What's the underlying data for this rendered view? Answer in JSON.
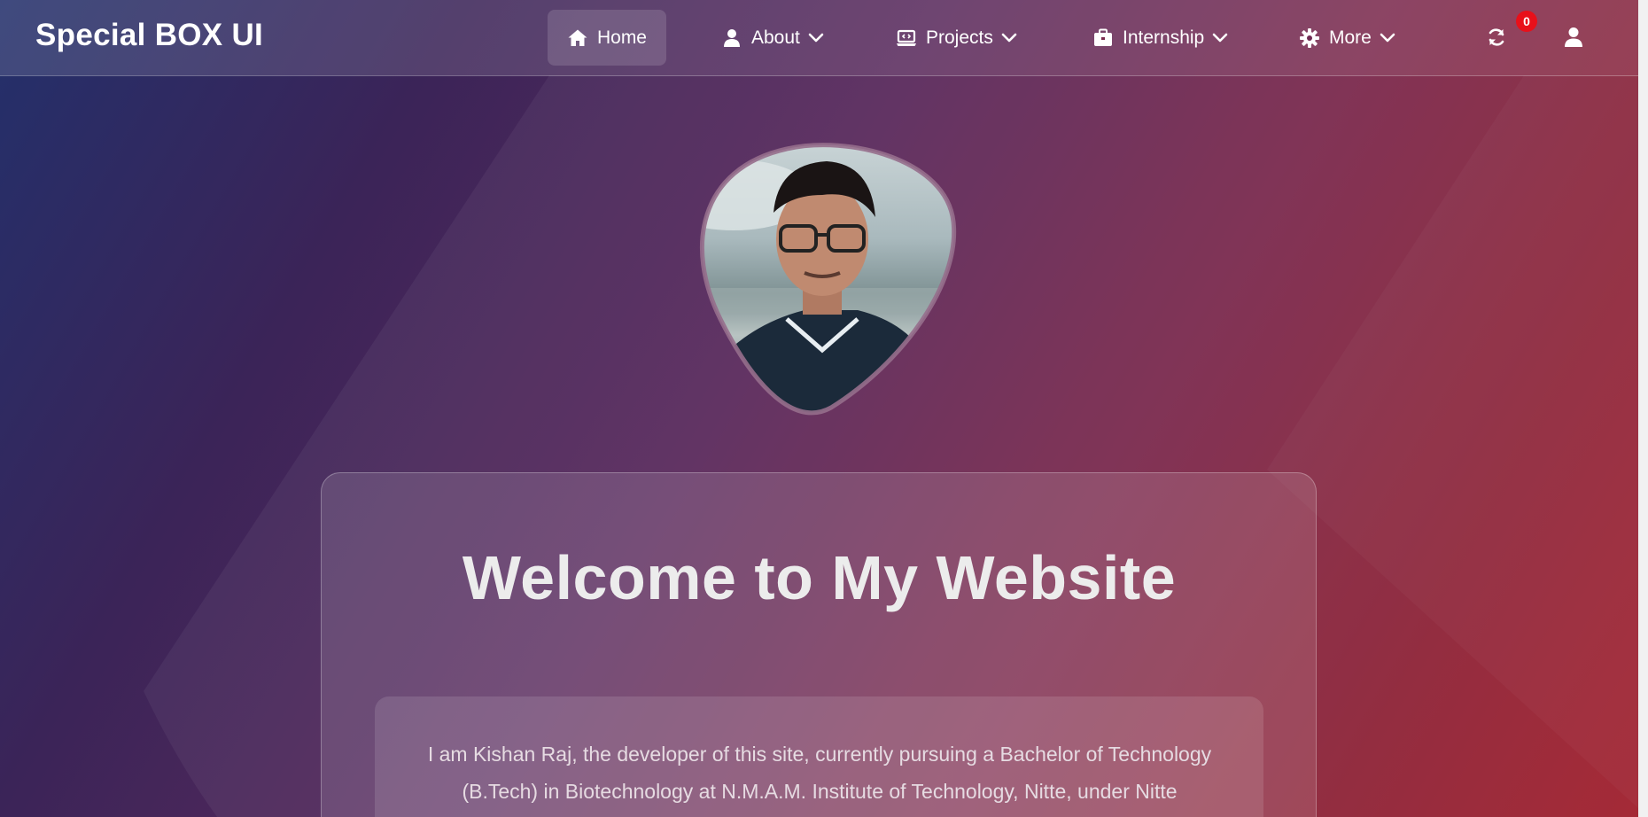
{
  "header": {
    "brand": "Special BOX UI",
    "nav": [
      {
        "label": "Home",
        "icon": "home-icon",
        "active": true
      },
      {
        "label": "About",
        "icon": "user-icon",
        "dropdown": true
      },
      {
        "label": "Projects",
        "icon": "laptop-code-icon",
        "dropdown": true
      },
      {
        "label": "Internship",
        "icon": "briefcase-icon",
        "dropdown": true
      },
      {
        "label": "More",
        "icon": "gear-icon",
        "dropdown": true
      }
    ],
    "refresh_badge_count": "0",
    "actions": [
      "refresh-icon",
      "profile-icon"
    ]
  },
  "hero": {
    "avatar_alt": "profile-photo",
    "title": "Welcome to My Website",
    "intro": "I am Kishan Raj, the developer of this site, currently pursuing a Bachelor of Technology (B.Tech) in Biotechnology at N.M.A.M. Institute of Technology, Nitte, under Nitte"
  },
  "colors": {
    "badge": "#e8101a",
    "gradient_start": "#23306b",
    "gradient_end": "#a11f2c"
  }
}
